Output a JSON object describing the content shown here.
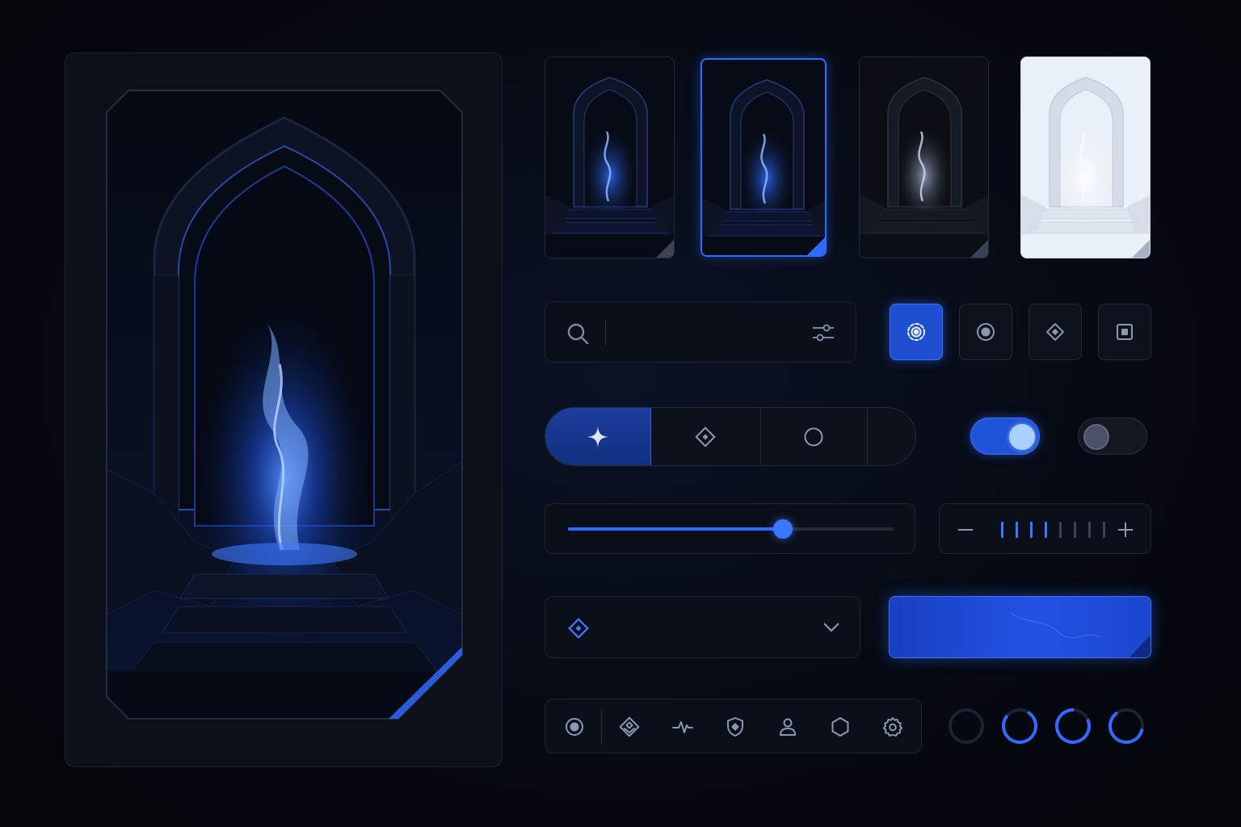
{
  "colors": {
    "accent": "#2f6bff",
    "accent_glow": "#5b8cff",
    "panel": "#0b0f19",
    "border": "#1b2233",
    "icon": "#7c88a3",
    "light_card": "#e8edf6"
  },
  "hero": {
    "art": "portal-archway-art"
  },
  "thumbnails": [
    {
      "variant": "blue",
      "selected": false
    },
    {
      "variant": "blue",
      "selected": true
    },
    {
      "variant": "gray",
      "selected": false
    },
    {
      "variant": "light",
      "selected": false
    }
  ],
  "search": {
    "value": "",
    "placeholder": "",
    "icon": "search-icon",
    "filter_icon": "sliders-icon"
  },
  "view_buttons": [
    {
      "icon": "target-icon",
      "active": true
    },
    {
      "icon": "radio-dot-icon",
      "active": false
    },
    {
      "icon": "diamond-icon",
      "active": false
    },
    {
      "icon": "square-dot-icon",
      "active": false
    }
  ],
  "segmented": [
    {
      "icon": "sparkle-icon",
      "active": true
    },
    {
      "icon": "diamond-icon",
      "active": false
    },
    {
      "icon": "circle-icon",
      "active": false
    },
    {
      "icon": "",
      "active": false
    }
  ],
  "toggles": [
    {
      "state": "on"
    },
    {
      "state": "off"
    }
  ],
  "slider": {
    "value": 0.66
  },
  "stepper": {
    "minus_icon": "minus-icon",
    "plus_icon": "plus-icon",
    "ticks_total": 8,
    "ticks_filled": 4
  },
  "dropdown": {
    "icon": "diamond-icon",
    "value": "",
    "chevron": "chevron-down-icon"
  },
  "primary_button": {
    "label": ""
  },
  "toolbar": [
    {
      "icon": "radio-dot-icon"
    },
    {
      "icon": "diamond-layers-icon"
    },
    {
      "icon": "pulse-icon"
    },
    {
      "icon": "shield-icon"
    },
    {
      "icon": "user-icon"
    },
    {
      "icon": "hexagon-icon"
    },
    {
      "icon": "gear-icon"
    }
  ],
  "progress_rings": [
    {
      "value": 0.0
    },
    {
      "value": 0.75
    },
    {
      "value": 0.8
    },
    {
      "value": 0.6
    }
  ]
}
